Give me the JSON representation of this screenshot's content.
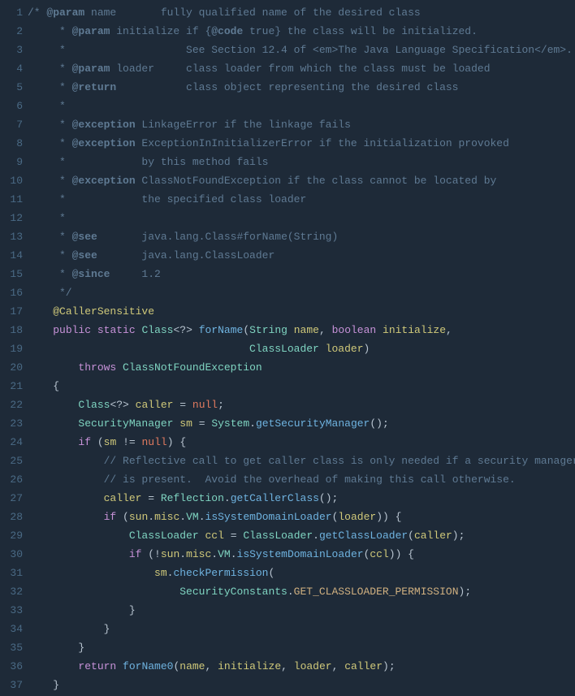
{
  "lines": [
    {
      "n": 1,
      "html": "<span class=\"tok-comment\">/* </span><span class=\"tok-doctag\">@param</span><span class=\"tok-comment\"> name       fully qualified name of the desired class</span>"
    },
    {
      "n": 2,
      "html": "<span class=\"tok-comment\">     * </span><span class=\"tok-doctag\">@param</span><span class=\"tok-comment\"> initialize if {</span><span class=\"tok-doctag\">@code</span><span class=\"tok-comment\"> true} the class will be initialized.</span>"
    },
    {
      "n": 3,
      "html": "<span class=\"tok-comment\">     *                   See Section 12.4 of &lt;em&gt;The Java Language Specification&lt;/em&gt;.</span>"
    },
    {
      "n": 4,
      "html": "<span class=\"tok-comment\">     * </span><span class=\"tok-doctag\">@param</span><span class=\"tok-comment\"> loader     class loader from which the class must be loaded</span>"
    },
    {
      "n": 5,
      "html": "<span class=\"tok-comment\">     * </span><span class=\"tok-doctag\">@return</span><span class=\"tok-comment\">           class object representing the desired class</span>"
    },
    {
      "n": 6,
      "html": "<span class=\"tok-comment\">     *</span>"
    },
    {
      "n": 7,
      "html": "<span class=\"tok-comment\">     * </span><span class=\"tok-doctag\">@exception</span><span class=\"tok-comment\"> LinkageError if the linkage fails</span>"
    },
    {
      "n": 8,
      "html": "<span class=\"tok-comment\">     * </span><span class=\"tok-doctag\">@exception</span><span class=\"tok-comment\"> ExceptionInInitializerError if the initialization provoked</span>"
    },
    {
      "n": 9,
      "html": "<span class=\"tok-comment\">     *            by this method fails</span>"
    },
    {
      "n": 10,
      "html": "<span class=\"tok-comment\">     * </span><span class=\"tok-doctag\">@exception</span><span class=\"tok-comment\"> ClassNotFoundException if the class cannot be located by</span>"
    },
    {
      "n": 11,
      "html": "<span class=\"tok-comment\">     *            the specified class loader</span>"
    },
    {
      "n": 12,
      "html": "<span class=\"tok-comment\">     *</span>"
    },
    {
      "n": 13,
      "html": "<span class=\"tok-comment\">     * </span><span class=\"tok-doctag\">@see</span><span class=\"tok-comment\">       java.lang.Class#forName(String)</span>"
    },
    {
      "n": 14,
      "html": "<span class=\"tok-comment\">     * </span><span class=\"tok-doctag\">@see</span><span class=\"tok-comment\">       java.lang.ClassLoader</span>"
    },
    {
      "n": 15,
      "html": "<span class=\"tok-comment\">     * </span><span class=\"tok-doctag\">@since</span><span class=\"tok-comment\">     1.2</span>"
    },
    {
      "n": 16,
      "html": "<span class=\"tok-comment\">     */</span>"
    },
    {
      "n": 17,
      "html": "    <span class=\"tok-annotation\">@CallerSensitive</span>"
    },
    {
      "n": 18,
      "html": "    <span class=\"tok-keyword\">public</span> <span class=\"tok-keyword\">static</span> <span class=\"tok-type\">Class</span><span class=\"tok-punct\">&lt;?&gt;</span> <span class=\"tok-method\">forName</span><span class=\"tok-punct\">(</span><span class=\"tok-type\">String</span> <span class=\"tok-param\">name</span><span class=\"tok-punct\">,</span> <span class=\"tok-keyword\">boolean</span> <span class=\"tok-param\">initialize</span><span class=\"tok-punct\">,</span>"
    },
    {
      "n": 19,
      "html": "                                   <span class=\"tok-type\">ClassLoader</span> <span class=\"tok-param\">loader</span><span class=\"tok-punct\">)</span>"
    },
    {
      "n": 20,
      "html": "        <span class=\"tok-keyword\">throws</span> <span class=\"tok-type\">ClassNotFoundException</span>"
    },
    {
      "n": 21,
      "html": "    <span class=\"tok-punct\">{</span>"
    },
    {
      "n": 22,
      "html": "        <span class=\"tok-type\">Class</span><span class=\"tok-punct\">&lt;?&gt;</span> <span class=\"tok-param\">caller</span> <span class=\"tok-punct\">=</span> <span class=\"tok-null\">null</span><span class=\"tok-punct\">;</span>"
    },
    {
      "n": 23,
      "html": "        <span class=\"tok-type\">SecurityManager</span> <span class=\"tok-param\">sm</span> <span class=\"tok-punct\">=</span> <span class=\"tok-type\">System</span><span class=\"tok-punct\">.</span><span class=\"tok-method\">getSecurityManager</span><span class=\"tok-punct\">();</span>"
    },
    {
      "n": 24,
      "html": "        <span class=\"tok-keyword\">if</span> <span class=\"tok-punct\">(</span><span class=\"tok-param\">sm</span> <span class=\"tok-punct\">!=</span> <span class=\"tok-null\">null</span><span class=\"tok-punct\">) {</span>"
    },
    {
      "n": 25,
      "html": "            <span class=\"tok-comment\">// Reflective call to get caller class is only needed if a security manager</span>"
    },
    {
      "n": 26,
      "html": "            <span class=\"tok-comment\">// is present.  Avoid the overhead of making this call otherwise.</span>"
    },
    {
      "n": 27,
      "html": "            <span class=\"tok-param\">caller</span> <span class=\"tok-punct\">=</span> <span class=\"tok-type\">Reflection</span><span class=\"tok-punct\">.</span><span class=\"tok-method\">getCallerClass</span><span class=\"tok-punct\">();</span>"
    },
    {
      "n": 28,
      "html": "            <span class=\"tok-keyword\">if</span> <span class=\"tok-punct\">(</span><span class=\"tok-param\">sun</span><span class=\"tok-punct\">.</span><span class=\"tok-param\">misc</span><span class=\"tok-punct\">.</span><span class=\"tok-type\">VM</span><span class=\"tok-punct\">.</span><span class=\"tok-method\">isSystemDomainLoader</span><span class=\"tok-punct\">(</span><span class=\"tok-param\">loader</span><span class=\"tok-punct\">)) {</span>"
    },
    {
      "n": 29,
      "html": "                <span class=\"tok-type\">ClassLoader</span> <span class=\"tok-param\">ccl</span> <span class=\"tok-punct\">=</span> <span class=\"tok-type\">ClassLoader</span><span class=\"tok-punct\">.</span><span class=\"tok-method\">getClassLoader</span><span class=\"tok-punct\">(</span><span class=\"tok-param\">caller</span><span class=\"tok-punct\">);</span>"
    },
    {
      "n": 30,
      "html": "                <span class=\"tok-keyword\">if</span> <span class=\"tok-punct\">(!</span><span class=\"tok-param\">sun</span><span class=\"tok-punct\">.</span><span class=\"tok-param\">misc</span><span class=\"tok-punct\">.</span><span class=\"tok-type\">VM</span><span class=\"tok-punct\">.</span><span class=\"tok-method\">isSystemDomainLoader</span><span class=\"tok-punct\">(</span><span class=\"tok-param\">ccl</span><span class=\"tok-punct\">)) {</span>"
    },
    {
      "n": 31,
      "html": "                    <span class=\"tok-param\">sm</span><span class=\"tok-punct\">.</span><span class=\"tok-method\">checkPermission</span><span class=\"tok-punct\">(</span>"
    },
    {
      "n": 32,
      "html": "                        <span class=\"tok-type\">SecurityConstants</span><span class=\"tok-punct\">.</span><span class=\"tok-const\">GET_CLASSLOADER_PERMISSION</span><span class=\"tok-punct\">);</span>"
    },
    {
      "n": 33,
      "html": "                <span class=\"tok-punct\">}</span>"
    },
    {
      "n": 34,
      "html": "            <span class=\"tok-punct\">}</span>"
    },
    {
      "n": 35,
      "html": "        <span class=\"tok-punct\">}</span>"
    },
    {
      "n": 36,
      "html": "        <span class=\"tok-keyword\">return</span> <span class=\"tok-method\">forName0</span><span class=\"tok-punct\">(</span><span class=\"tok-param\">name</span><span class=\"tok-punct\">,</span> <span class=\"tok-param\">initialize</span><span class=\"tok-punct\">,</span> <span class=\"tok-param\">loader</span><span class=\"tok-punct\">,</span> <span class=\"tok-param\">caller</span><span class=\"tok-punct\">);</span>"
    },
    {
      "n": 37,
      "html": "    <span class=\"tok-punct\">}</span>"
    }
  ]
}
